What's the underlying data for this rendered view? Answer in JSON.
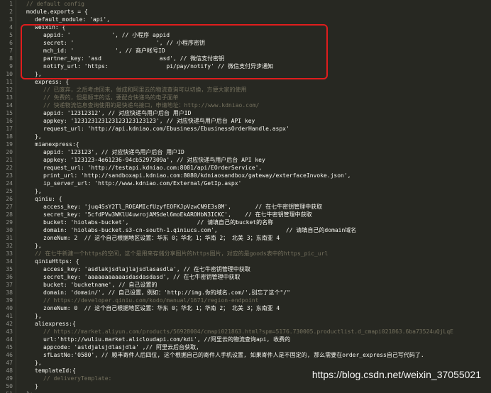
{
  "lines": [
    {
      "n": "1",
      "t": "// default config",
      "c": "cmt",
      "ind": 0
    },
    {
      "n": "2",
      "t": "module.exports = {",
      "c": "",
      "ind": 0
    },
    {
      "n": "3",
      "t": "default_module: 'api',",
      "c": "",
      "ind": 1
    },
    {
      "n": "4",
      "t": "weixin: {",
      "c": "",
      "ind": 1
    },
    {
      "n": "5",
      "t": "appid: '            ', // 小程序 appid",
      "c": "",
      "ind": 2
    },
    {
      "n": "6",
      "t": "secret: '                        ', // 小程序密钥",
      "c": "",
      "ind": 2
    },
    {
      "n": "7",
      "t": "mch_id: '            ', // 商户帐号ID",
      "c": "",
      "ind": 2
    },
    {
      "n": "8",
      "t": "partner_key: 'asd                 asd', // 微信支付密钥",
      "c": "",
      "ind": 2
    },
    {
      "n": "9",
      "t": "notify_url: 'https:                 pi/pay/notify' // 微信支付异步通知",
      "c": "",
      "ind": 2
    },
    {
      "n": "10",
      "t": "},",
      "c": "",
      "ind": 1
    },
    {
      "n": "11",
      "t": "express: {",
      "c": "",
      "ind": 1
    },
    {
      "n": "12",
      "t": "// 已废弃，之后考虑回来，做成和阿里云的物流查询可以切换，方便大家的使用",
      "c": "cmt",
      "ind": 2
    },
    {
      "n": "13",
      "t": "// 免费的，但是顺丰的话，要配合快递鸟的电子面单",
      "c": "cmt",
      "ind": 2
    },
    {
      "n": "14",
      "t": "// 快递物流信息查询使用的是快递鸟接口，申请地址：http://www.kdniao.com/",
      "c": "cmt",
      "ind": 2
    },
    {
      "n": "15",
      "t": "appid: '12312312', // 对应快递鸟用户后台 用户ID",
      "c": "",
      "ind": 2
    },
    {
      "n": "16",
      "t": "appkey: '123123123123123123123123', // 对应快递鸟用户后台 API key",
      "c": "",
      "ind": 2
    },
    {
      "n": "17",
      "t": "request_url: 'http://api.kdniao.com/Ebusiness/EbusinessOrderHandle.aspx'",
      "c": "",
      "ind": 2
    },
    {
      "n": "18",
      "t": "},",
      "c": "",
      "ind": 1
    },
    {
      "n": "19",
      "t": "mianexpress:{",
      "c": "",
      "ind": 1
    },
    {
      "n": "20",
      "t": "appid: '123123', // 对应快递鸟用户后台 用户ID",
      "c": "",
      "ind": 2
    },
    {
      "n": "21",
      "t": "appkey: '123123-4e61236-94cb5297309a', // 对应快递鸟用户后台 API key",
      "c": "",
      "ind": 2
    },
    {
      "n": "22",
      "t": "request_url: 'http://testapi.kdniao.com:8081/api/EOrderService',",
      "c": "",
      "ind": 2
    },
    {
      "n": "23",
      "t": "print_url: 'http://sandboxapi.kdniao.com:8080/kdniaosandbox/gateway/exterfaceInvoke.json',",
      "c": "",
      "ind": 2
    },
    {
      "n": "24",
      "t": "ip_server_url: 'http://www.kdniao.com/External/GetIp.aspx'",
      "c": "",
      "ind": 2
    },
    {
      "n": "25",
      "t": "},",
      "c": "",
      "ind": 1
    },
    {
      "n": "26",
      "t": "qiniu: {",
      "c": "",
      "ind": 1
    },
    {
      "n": "27",
      "t": "access_key: 'juq4SsY2Tl_ROEAMIcfUzyfEOFKJpVzwCN9E3s8M',       // 在七牛密钥管理中获取",
      "c": "",
      "ind": 2
    },
    {
      "n": "28",
      "t": "secret_key: '5cfdPVw3WKlU4uwrojAMSdel6moEkAROHbN3ICKC',    // 在七牛密钥管理中获取",
      "c": "",
      "ind": 2
    },
    {
      "n": "29",
      "t": "bucket: 'hiolabs-bucket',                    // 请填自己的bucket的名称",
      "c": "",
      "ind": 2
    },
    {
      "n": "30",
      "t": "domain: 'hiolabs-bucket.s3-cn-south-1.qiniucs.com',                    // 请填自己的domain域名",
      "c": "",
      "ind": 2
    },
    {
      "n": "31",
      "t": "zoneNum: 2  // 这个自己根据地区设置：华东 0；华北 1；华南 2； 北美 3；东南亚 4",
      "c": "",
      "ind": 2
    },
    {
      "n": "32",
      "t": "},",
      "c": "",
      "ind": 1
    },
    {
      "n": "33",
      "t": "// 在七牛新建一个https的空间，这个是用来存储分享图片的https图片，对应的是goods表中的https_pic_url",
      "c": "cmt",
      "ind": 1
    },
    {
      "n": "34",
      "t": "qiniuHttps: {",
      "c": "",
      "ind": 1
    },
    {
      "n": "35",
      "t": "access_key: 'asdlakjsdlajlajsdlasasdla', // 在七牛密钥管理中获取",
      "c": "",
      "ind": 2
    },
    {
      "n": "36",
      "t": "secret_key: 'aaaaaaaaaaasdasdasdasd', // 在七牛密钥管理中获取",
      "c": "",
      "ind": 2
    },
    {
      "n": "37",
      "t": "bucket: 'bucketname', // 自己设置的",
      "c": "",
      "ind": 2
    },
    {
      "n": "38",
      "t": "domain: 'domain/', // 自己设置，例如：'http://img.你的域名.com/',别忘了这个\"/\"",
      "c": "",
      "ind": 2
    },
    {
      "n": "39",
      "t": "// https://developer.qiniu.com/kodo/manual/1671/region-endpoint",
      "c": "cmt",
      "ind": 2
    },
    {
      "n": "40",
      "t": "zoneNum: 0  // 这个自己根据地区设置：华东 0；华北 1；华南 2； 北美 3；东南亚 4",
      "c": "",
      "ind": 2
    },
    {
      "n": "41",
      "t": "},",
      "c": "",
      "ind": 1
    },
    {
      "n": "42",
      "t": "aliexpress:{",
      "c": "",
      "ind": 1
    },
    {
      "n": "43",
      "t": "// https://market.aliyun.com/products/56928004/cmapi021863.html?spm=5176.730005.productlist.d_cmapi021863.6ba73524uQjLqE",
      "c": "cmt",
      "ind": 2
    },
    {
      "n": "44",
      "t": "url:'http://wuliu.market.alicloudapi.com/kdi', //阿里云的物流查询api, 收费的",
      "c": "",
      "ind": 2
    },
    {
      "n": "45",
      "t": "appcode: 'asldjalsjdlasjdla' ,// 阿里云后台获取,",
      "c": "",
      "ind": 2
    },
    {
      "n": "46",
      "t": "sfLastNo:'0580', // 顺丰寄件人后四位, 这个根据自己的寄件人手机设置, 如果寄件人是不固定的, 那么需要在order_express自己写代码了.",
      "c": "",
      "ind": 2
    },
    {
      "n": "47",
      "t": "},",
      "c": "",
      "ind": 1
    },
    {
      "n": "48",
      "t": "templateId:{",
      "c": "",
      "ind": 1
    },
    {
      "n": "49",
      "t": "// deliveryTemplate:",
      "c": "cmt",
      "ind": 2
    },
    {
      "n": "50",
      "t": "}",
      "c": "",
      "ind": 1
    },
    {
      "n": "51",
      "t": "};",
      "c": "",
      "ind": 0
    }
  ],
  "watermark": "https://blog.csdn.net/weixin_37055021"
}
